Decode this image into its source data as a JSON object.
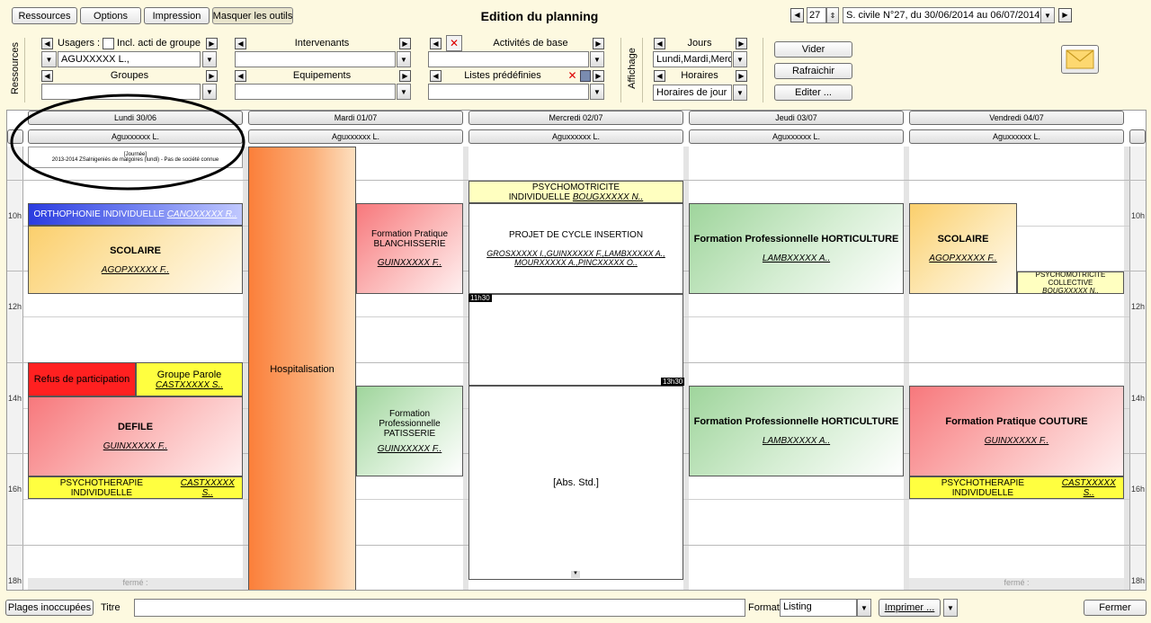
{
  "toolbar": {
    "ressources": "Ressources",
    "options": "Options",
    "impression": "Impression",
    "masquer": "Masquer les outils",
    "title": "Edition du planning",
    "week_num": "27",
    "week_range": "S. civile N°27, du 30/06/2014 au 06/07/2014"
  },
  "filters": {
    "side_label": "Ressources",
    "usagers_label": "Usagers :",
    "incl_label": "Incl. acti de groupe",
    "usagers_value": "AGUXXXXX L.,",
    "groupes_label": "Groupes",
    "intervenants_label": "Intervenants",
    "equipements_label": "Equipements",
    "activites_label": "Activités de base",
    "listes_label": "Listes prédéfinies",
    "affichage_label": "Affichage",
    "jours_label": "Jours",
    "jours_value": "Lundi,Mardi,Merc",
    "horaires_label": "Horaires",
    "horaires_value": "Horaires de jour",
    "vider": "Vider",
    "rafraichir": "Rafraichir",
    "editer": "Editer ..."
  },
  "planning": {
    "days": [
      {
        "label": "Lundi 30/06",
        "resource": "Aguxxxxxx L."
      },
      {
        "label": "Mardi 01/07",
        "resource": "Aguxxxxxx L."
      },
      {
        "label": "Mercredi 02/07",
        "resource": "Aguxxxxxx L."
      },
      {
        "label": "Jeudi 03/07",
        "resource": "Aguxxxxxx L."
      },
      {
        "label": "Vendredi 04/07",
        "resource": "Aguxxxxxx L."
      }
    ],
    "hours": [
      "10h",
      "12h",
      "14h",
      "16h",
      "18h"
    ],
    "events": {
      "journee_title": "[Journée]",
      "journee_text": "2013-2014 ZSalnigeniés de malgoires (lundi) - Pas de société connue",
      "ortho": "ORTHOPHONIE INDIVIDUELLE",
      "ortho_who": "CANOXXXXX R..",
      "scolaire": "SCOLAIRE",
      "scolaire_who": "AGOPXXXXX F..",
      "refus": "Refus de participation",
      "groupe_parole": "Groupe Parole",
      "groupe_parole_who": "CASTXXXXX S..",
      "defile": "DEFILE",
      "defile_who": "GUINXXXXX F..",
      "psychoth_mon": "PSYCHOTHERAPIE INDIVIDUELLE",
      "psychoth_mon_who": "CASTXXXXX S..",
      "hospitalisation": "Hospitalisation",
      "fp_blanch": "Formation Pratique BLANCHISSERIE",
      "fp_blanch_who": "GUINXXXXX F..",
      "fpro_patiss": "Formation Professionnelle PATISSERIE",
      "fpro_patiss_who": "GUINXXXXX F..",
      "psychomot_wed": "PSYCHOMOTRICITE INDIVIDUELLE",
      "psychomot_wed_who": "BOUGXXXXX N..",
      "projet": "PROJET DE CYCLE INSERTION",
      "projet_who": "GROSXXXXX I.,GUINXXXXX F.,LAMBXXXXX A., MOURXXXXX A.,PINCXXXXX O..",
      "time_start": "11h30",
      "time_end": "13h30",
      "abs_std": "[Abs. Std.]",
      "fpro_hort": "Formation Professionnelle HORTICULTURE",
      "fpro_hort_who": "LAMBXXXXX A..",
      "scolaire_fri_who": "AGOPXXXXX F..",
      "psychomot_coll": "PSYCHOMOTRICITE COLLECTIVE",
      "psychomot_coll_who": "BOUGXXXXX N..",
      "fp_couture": "Formation Pratique COUTURE",
      "fp_couture_who": "GUINXXXXX F..",
      "psychoth_fri": "PSYCHOTHERAPIE INDIVIDUELLE",
      "psychoth_fri_who": "CASTXXXXX S..",
      "ferme": "fermé :"
    }
  },
  "bottom": {
    "plages": "Plages inoccupées",
    "titre_label": "Titre",
    "titre_value": "",
    "format_label": "Format",
    "format_value": "Listing",
    "imprimer": "Imprimer ...",
    "fermer": "Fermer"
  }
}
